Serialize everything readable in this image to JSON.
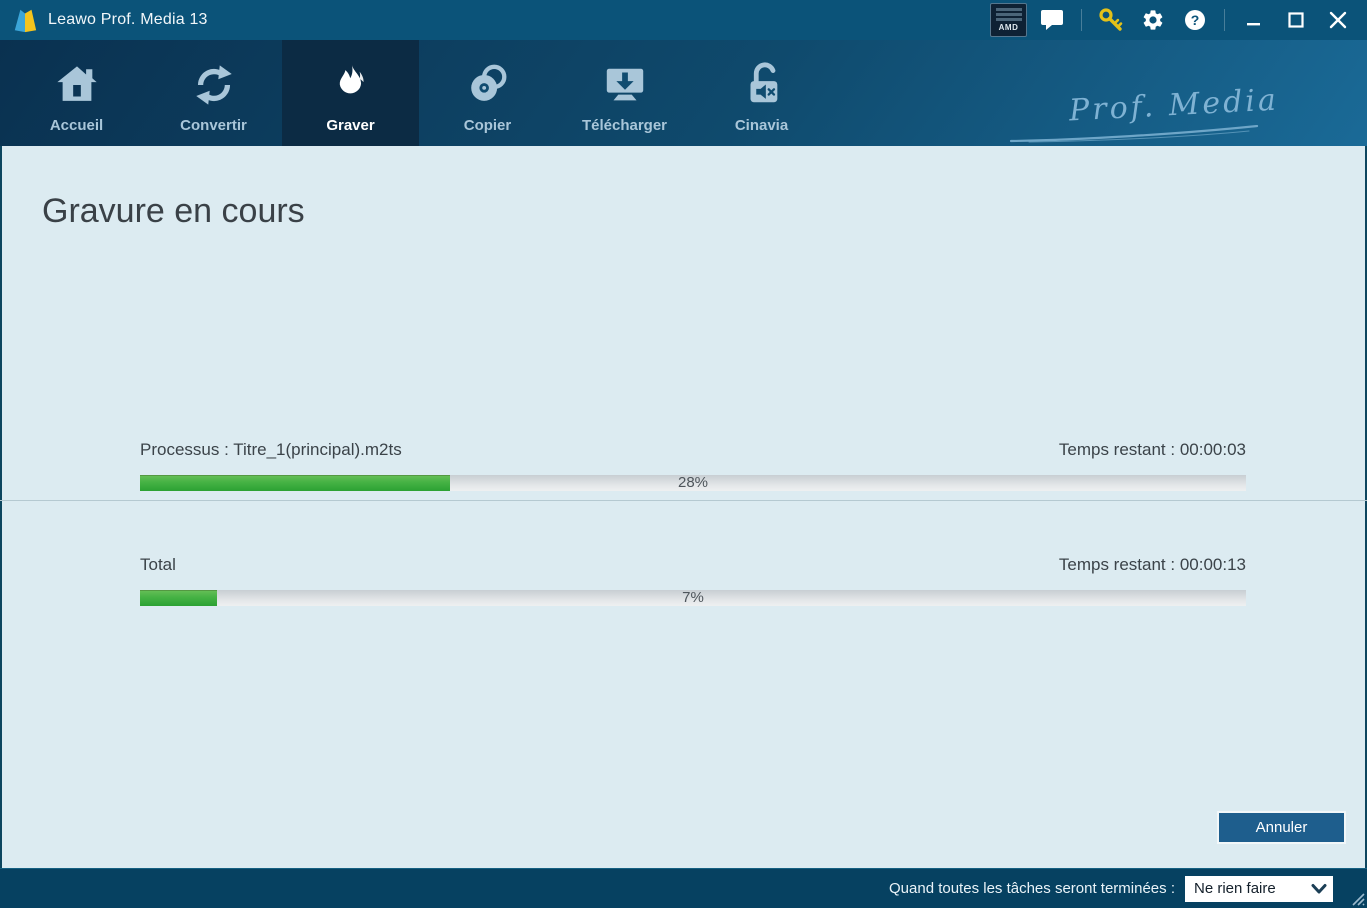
{
  "titlebar": {
    "app_title": "Leawo Prof. Media 13",
    "amd_badge_label": "AMD",
    "icons": [
      "amd-radeon-badge",
      "feedback-bubble-icon",
      "license-key-icon",
      "settings-gear-icon",
      "help-icon",
      "minimize-icon",
      "maximize-icon",
      "close-icon"
    ]
  },
  "nav": {
    "brand": "Prof. Media",
    "tabs": [
      {
        "label": "Accueil",
        "icon": "home-icon",
        "active": false
      },
      {
        "label": "Convertir",
        "icon": "convert-arrows-icon",
        "active": false
      },
      {
        "label": "Graver",
        "icon": "burn-flame-icon",
        "active": true
      },
      {
        "label": "Copier",
        "icon": "disc-copy-icon",
        "active": false
      },
      {
        "label": "Télécharger",
        "icon": "download-icon",
        "active": false
      },
      {
        "label": "Cinavia",
        "icon": "cinavia-unlock-icon",
        "active": false
      }
    ]
  },
  "main": {
    "heading": "Gravure en cours",
    "tasks": [
      {
        "label": "Processus : Titre_1(principal).m2ts",
        "time_remaining": "Temps restant : 00:00:03",
        "percent": 28,
        "percent_label": "28%"
      },
      {
        "label": "Total",
        "time_remaining": "Temps restant : 00:00:13",
        "percent": 7,
        "percent_label": "7%"
      }
    ],
    "cancel_label": "Annuler"
  },
  "footer": {
    "prompt": "Quand toutes les tâches seront terminées :",
    "selected_option": "Ne rien faire"
  },
  "colors": {
    "titlebar_bg": "#0b5379",
    "nav_active_tab_bg": "#0c2b44",
    "content_bg": "#dcebf1",
    "progress_green": "#3fae3c",
    "progress_track": "#d4d9dc",
    "cancel_button_blue": "#1e5e8d",
    "footer_bg": "#064161",
    "key_yellow": "#e3c119",
    "inactive_tab_color": "#a9c6d9"
  }
}
